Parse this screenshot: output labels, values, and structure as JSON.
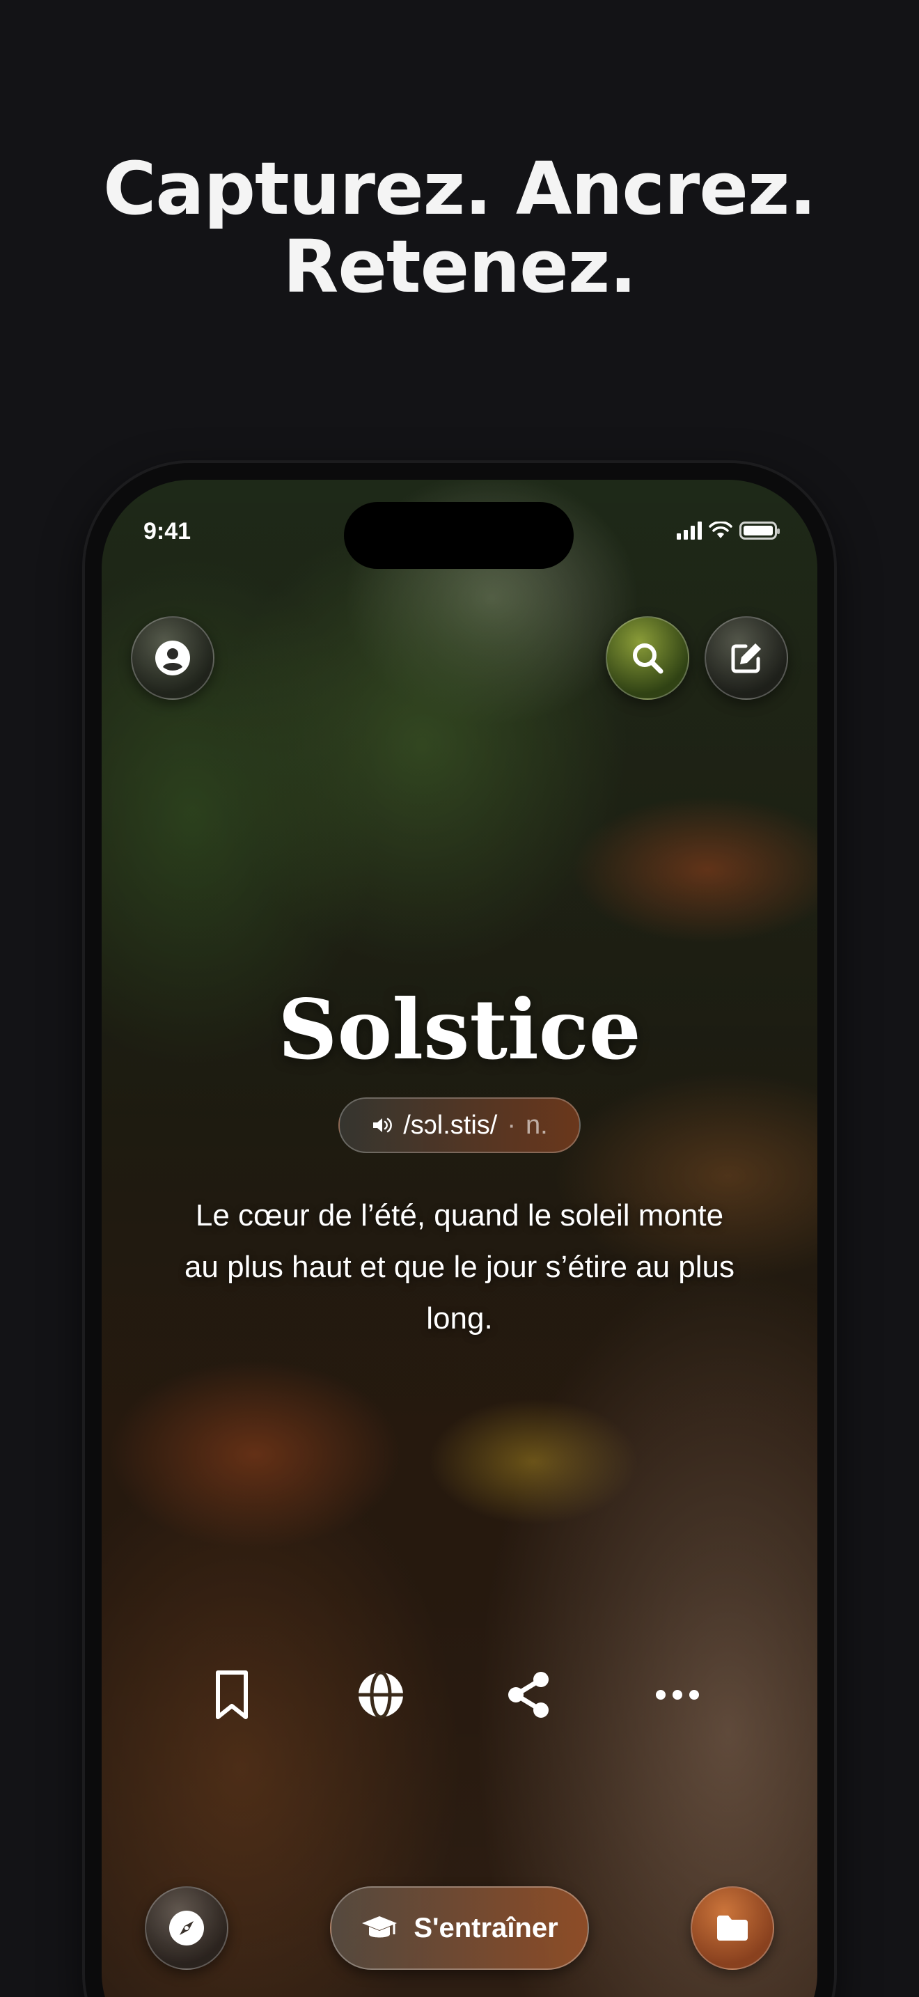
{
  "headline": {
    "line1": "Capturez. Ancrez.",
    "line2": "Retenez."
  },
  "status_bar": {
    "time": "9:41",
    "icons": [
      "cellular-signal-icon",
      "wifi-icon",
      "battery-icon"
    ]
  },
  "top_buttons": {
    "profile_icon": "user-circle-icon",
    "search_icon": "search-icon",
    "edit_icon": "edit-icon"
  },
  "word_card": {
    "word": "Solstice",
    "pronunciation": "/sɔl.stis/",
    "separator": "·",
    "part_of_speech": "n.",
    "definition": "Le cœur de l’été, quand le soleil monte au plus haut et que le jour s’étire au plus long."
  },
  "actions": [
    "bookmark-icon",
    "globe-icon",
    "share-icon",
    "more-icon"
  ],
  "bottom_bar": {
    "explore_icon": "compass-icon",
    "train_label": "S'entraîner",
    "train_icon": "graduation-cap-icon",
    "folder_icon": "folder-icon"
  },
  "colors": {
    "background": "#131316",
    "search_button": "#5a6e1e",
    "train_button": "#96502a",
    "folder_button": "#a8562a"
  }
}
